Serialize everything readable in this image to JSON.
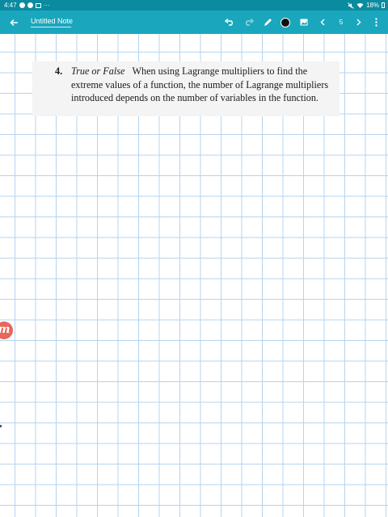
{
  "status_bar": {
    "time": "4:47",
    "extra": "···",
    "battery_text": "18%"
  },
  "toolbar": {
    "note_title": "Untitled Note",
    "page_number": "5",
    "pen_color": "#111111",
    "icons": [
      "back-arrow-icon",
      "undo-icon",
      "redo-icon",
      "pen-icon",
      "color-dot",
      "image-icon",
      "chevron-left-icon",
      "chevron-right-icon",
      "more-vert-icon"
    ]
  },
  "problem": {
    "number": "4.",
    "lead": "True or False",
    "body": "When using Lagrange multipliers to find the extreme values of a function, the number of Lagrange multipliers introduced depends on the number of variables in the function."
  },
  "side_logo": {
    "letter": "m"
  },
  "colors": {
    "status_bar": "#0a8ba0",
    "toolbar": "#1aa7bd",
    "grid": "#b5d4ef",
    "card": "#f4f4f4",
    "logo": "#e8665a"
  }
}
